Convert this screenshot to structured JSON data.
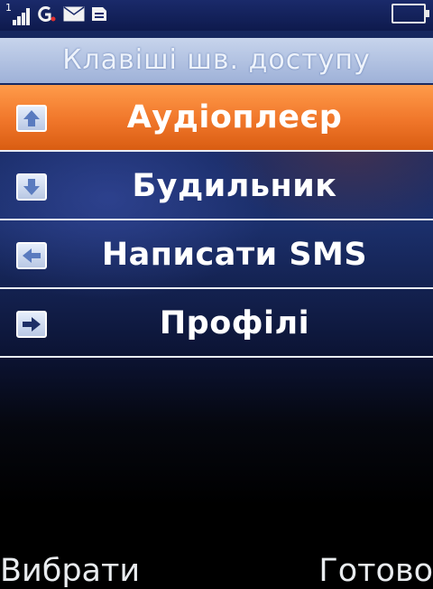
{
  "status_bar": {
    "sim_slot": "1",
    "signal_level": 4,
    "icons": [
      "signal-icon",
      "gprs-icon",
      "message-icon",
      "memory-card-icon",
      "battery-icon"
    ]
  },
  "title": "Клавіші шв. доступу",
  "menu": {
    "selected_index": 0,
    "items": [
      {
        "label": "Аудіоплеєр",
        "key": "up-arrow-icon"
      },
      {
        "label": "Будильник",
        "key": "down-arrow-icon"
      },
      {
        "label": "Написати SMS",
        "key": "left-arrow-icon"
      },
      {
        "label": "Профілі",
        "key": "right-arrow-icon"
      }
    ]
  },
  "softkeys": {
    "left": "Вибрати",
    "right": "Готово"
  },
  "colors": {
    "selected_item": "#f0762a",
    "title_bar": "#b4c4e4",
    "divider": "#e8ecf4"
  }
}
